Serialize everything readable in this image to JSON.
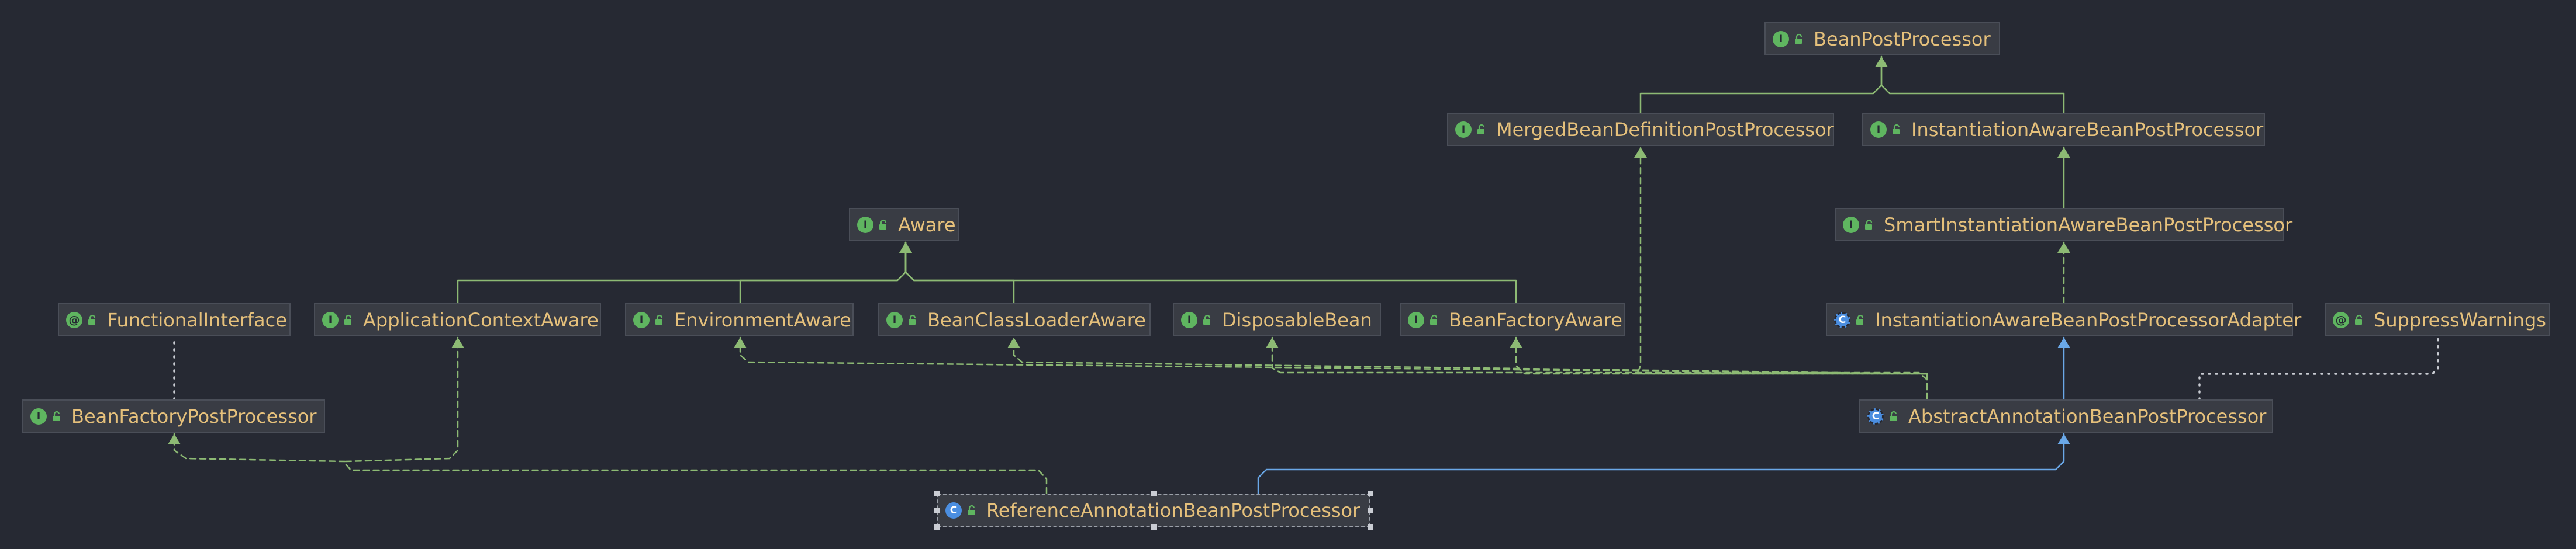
{
  "colors": {
    "background": "#262933",
    "node_fill": "#393c44",
    "node_text": "#e5c07b",
    "interface_icon": "#5fb560",
    "class_icon": "#4b8ee0",
    "interface_edge": "#8dba74",
    "extends_edge": "#6aa8e8",
    "annotation_edge": "#c9ccd3"
  },
  "nodes": [
    {
      "id": "BeanPostProcessor",
      "label": "BeanPostProcessor",
      "kind": "interface",
      "icon": "interface-icon"
    },
    {
      "id": "MergedBeanDefinitionPostProcessor",
      "label": "MergedBeanDefinitionPostProcessor",
      "kind": "interface",
      "icon": "interface-icon"
    },
    {
      "id": "InstantiationAwareBeanPostProcessor",
      "label": "InstantiationAwareBeanPostProcessor",
      "kind": "interface",
      "icon": "interface-icon"
    },
    {
      "id": "Aware",
      "label": "Aware",
      "kind": "interface",
      "icon": "interface-icon"
    },
    {
      "id": "SmartInstantiationAwareBeanPostProcessor",
      "label": "SmartInstantiationAwareBeanPostProcessor",
      "kind": "interface",
      "icon": "interface-icon"
    },
    {
      "id": "FunctionalInterface",
      "label": "FunctionalInterface",
      "kind": "annotation",
      "icon": "annotation-icon"
    },
    {
      "id": "ApplicationContextAware",
      "label": "ApplicationContextAware",
      "kind": "interface",
      "icon": "interface-icon"
    },
    {
      "id": "EnvironmentAware",
      "label": "EnvironmentAware",
      "kind": "interface",
      "icon": "interface-icon"
    },
    {
      "id": "BeanClassLoaderAware",
      "label": "BeanClassLoaderAware",
      "kind": "interface",
      "icon": "interface-icon"
    },
    {
      "id": "DisposableBean",
      "label": "DisposableBean",
      "kind": "interface",
      "icon": "interface-icon"
    },
    {
      "id": "BeanFactoryAware",
      "label": "BeanFactoryAware",
      "kind": "interface",
      "icon": "interface-icon"
    },
    {
      "id": "InstantiationAwareBeanPostProcessorAdapter",
      "label": "InstantiationAwareBeanPostProcessorAdapter",
      "kind": "abstract-class",
      "icon": "abstract-class-icon"
    },
    {
      "id": "SuppressWarnings",
      "label": "SuppressWarnings",
      "kind": "annotation",
      "icon": "annotation-icon"
    },
    {
      "id": "BeanFactoryPostProcessor",
      "label": "BeanFactoryPostProcessor",
      "kind": "interface",
      "icon": "interface-icon"
    },
    {
      "id": "AbstractAnnotationBeanPostProcessor",
      "label": "AbstractAnnotationBeanPostProcessor",
      "kind": "abstract-class",
      "icon": "abstract-class-icon"
    },
    {
      "id": "ReferenceAnnotationBeanPostProcessor",
      "label": "ReferenceAnnotationBeanPostProcessor",
      "kind": "class",
      "icon": "class-icon",
      "selected": true
    }
  ],
  "edges": [
    {
      "from": "MergedBeanDefinitionPostProcessor",
      "to": "BeanPostProcessor",
      "type": "extends-interface"
    },
    {
      "from": "InstantiationAwareBeanPostProcessor",
      "to": "BeanPostProcessor",
      "type": "extends-interface"
    },
    {
      "from": "SmartInstantiationAwareBeanPostProcessor",
      "to": "InstantiationAwareBeanPostProcessor",
      "type": "extends-interface"
    },
    {
      "from": "ApplicationContextAware",
      "to": "Aware",
      "type": "extends-interface"
    },
    {
      "from": "EnvironmentAware",
      "to": "Aware",
      "type": "extends-interface"
    },
    {
      "from": "BeanClassLoaderAware",
      "to": "Aware",
      "type": "extends-interface"
    },
    {
      "from": "BeanFactoryAware",
      "to": "Aware",
      "type": "extends-interface"
    },
    {
      "from": "InstantiationAwareBeanPostProcessorAdapter",
      "to": "SmartInstantiationAwareBeanPostProcessor",
      "type": "implements"
    },
    {
      "from": "AbstractAnnotationBeanPostProcessor",
      "to": "InstantiationAwareBeanPostProcessorAdapter",
      "type": "extends-class"
    },
    {
      "from": "AbstractAnnotationBeanPostProcessor",
      "to": "MergedBeanDefinitionPostProcessor",
      "type": "implements"
    },
    {
      "from": "AbstractAnnotationBeanPostProcessor",
      "to": "BeanFactoryAware",
      "type": "implements"
    },
    {
      "from": "AbstractAnnotationBeanPostProcessor",
      "to": "BeanClassLoaderAware",
      "type": "implements"
    },
    {
      "from": "AbstractAnnotationBeanPostProcessor",
      "to": "EnvironmentAware",
      "type": "implements"
    },
    {
      "from": "AbstractAnnotationBeanPostProcessor",
      "to": "DisposableBean",
      "type": "implements"
    },
    {
      "from": "AbstractAnnotationBeanPostProcessor",
      "to": "SuppressWarnings",
      "type": "annotated-with"
    },
    {
      "from": "BeanFactoryPostProcessor",
      "to": "FunctionalInterface",
      "type": "annotated-with"
    },
    {
      "from": "ReferenceAnnotationBeanPostProcessor",
      "to": "AbstractAnnotationBeanPostProcessor",
      "type": "extends-class"
    },
    {
      "from": "ReferenceAnnotationBeanPostProcessor",
      "to": "ApplicationContextAware",
      "type": "implements"
    },
    {
      "from": "ReferenceAnnotationBeanPostProcessor",
      "to": "BeanFactoryPostProcessor",
      "type": "implements"
    }
  ]
}
